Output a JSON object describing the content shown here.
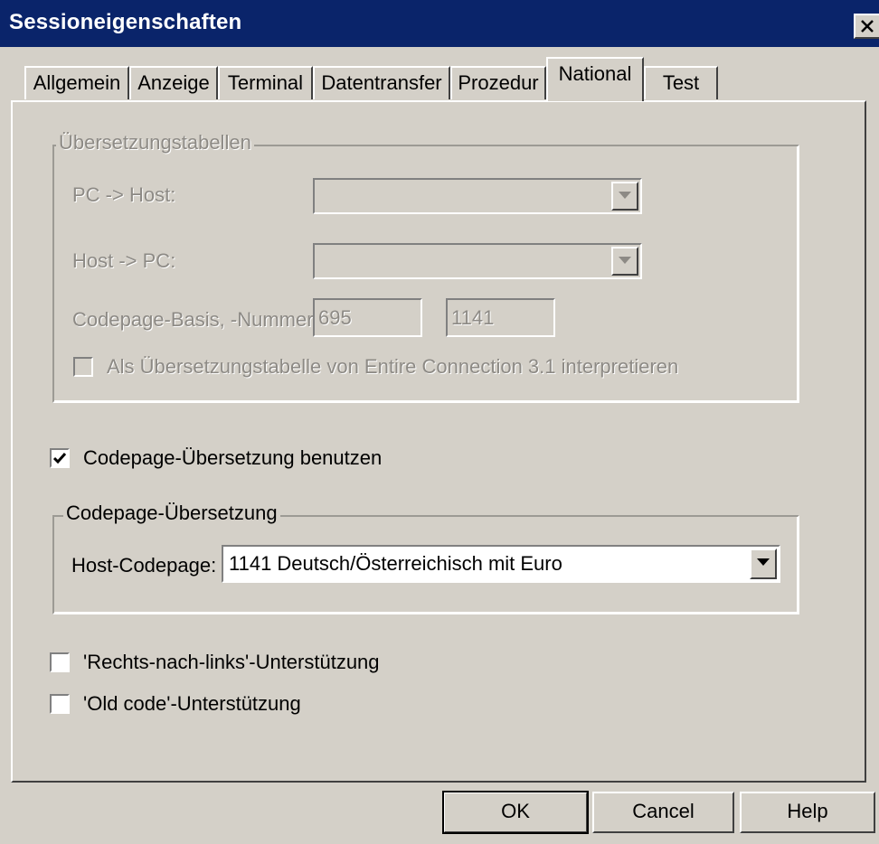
{
  "window": {
    "title": "Sessioneigenschaften"
  },
  "tabs": [
    {
      "label": "Allgemein",
      "active": false
    },
    {
      "label": "Anzeige",
      "active": false
    },
    {
      "label": "Terminal",
      "active": false
    },
    {
      "label": "Datentransfer",
      "active": false
    },
    {
      "label": "Prozedur",
      "active": false
    },
    {
      "label": "National",
      "active": true
    },
    {
      "label": "Test",
      "active": false
    }
  ],
  "translation_tables": {
    "group_label": "Übersetzungstabellen",
    "pc_to_host_label": "PC -> Host:",
    "pc_to_host_value": "",
    "host_to_pc_label": "Host -> PC:",
    "host_to_pc_value": "",
    "codepage_label": "Codepage-Basis, -Nummer:",
    "codepage_base": "695",
    "codepage_number": "1141",
    "ec31_checkbox_label": "Als Übersetzungstabelle von Entire Connection 3.1 interpretieren",
    "ec31_checked": false
  },
  "use_codepage_translation": {
    "label": "Codepage-Übersetzung benutzen",
    "checked": true
  },
  "codepage_translation": {
    "group_label": "Codepage-Übersetzung",
    "host_codepage_label": "Host-Codepage:",
    "host_codepage_value": "1141 Deutsch/Österreichisch mit Euro"
  },
  "rtl_support": {
    "label": "'Rechts-nach-links'-Unterstützung",
    "checked": false
  },
  "old_code_support": {
    "label": "'Old code'-Unterstützung",
    "checked": false
  },
  "buttons": {
    "ok": "OK",
    "cancel": "Cancel",
    "help": "Help"
  }
}
